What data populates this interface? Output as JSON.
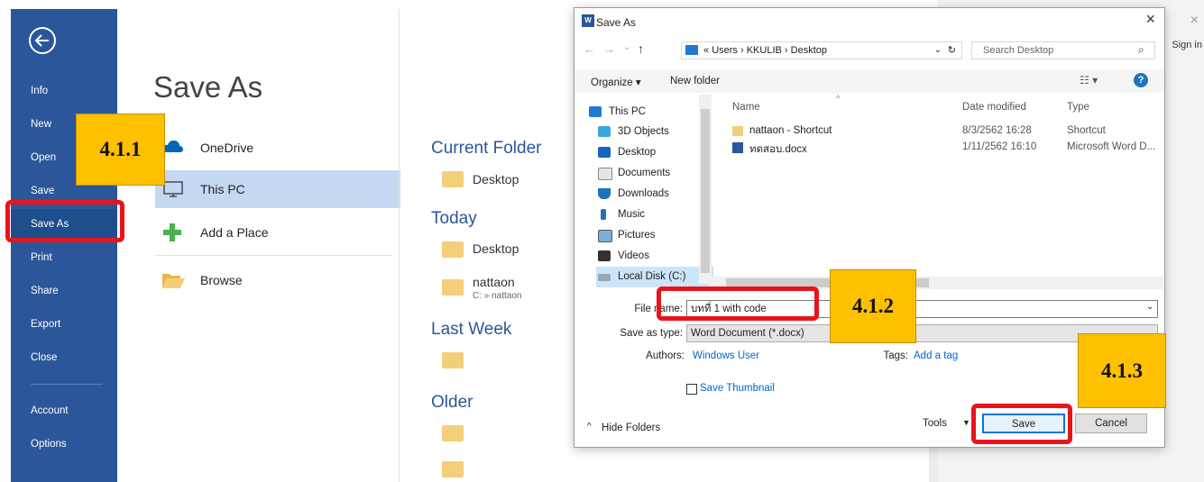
{
  "sidebar": {
    "items": [
      "Info",
      "New",
      "Open",
      "Save",
      "Save As",
      "Print",
      "Share",
      "Export",
      "Close",
      "Account",
      "Options"
    ],
    "active": "Save As"
  },
  "main": {
    "title": "Save As",
    "locations": [
      "OneDrive",
      "This PC",
      "Add a Place",
      "Browse"
    ],
    "sections": {
      "current_folder": "Current Folder",
      "today": "Today",
      "last_week": "Last Week",
      "older": "Older"
    },
    "folders": {
      "current": "Desktop",
      "today_1": "Desktop",
      "today_2": "nattaon",
      "today_2_path": "C: » nattaon"
    }
  },
  "right_panel": {
    "sign_in": "Sign in",
    "close_glyph": "×"
  },
  "dialog": {
    "title": "Save As",
    "address_path": [
      "«",
      "Users",
      "›",
      "KKULIB",
      "›",
      "Desktop"
    ],
    "search_placeholder": "Search Desktop",
    "organize": "Organize ▾",
    "new_folder": "New folder",
    "tree": [
      "This PC",
      "3D Objects",
      "Desktop",
      "Documents",
      "Downloads",
      "Music",
      "Pictures",
      "Videos",
      "Local Disk (C:)"
    ],
    "columns": [
      "Name",
      "Date modified",
      "Type"
    ],
    "files": [
      {
        "name": "nattaon - Shortcut",
        "date": "8/3/2562 16:28",
        "type": "Shortcut"
      },
      {
        "name": "ทดสอบ.docx",
        "date": "1/11/2562 16:10",
        "type": "Microsoft Word D..."
      }
    ],
    "file_name_label": "File name:",
    "file_name_value": "บทที่ 1 with code",
    "save_type_label": "Save as type:",
    "save_type_value": "Word Document (*.docx)",
    "authors_label": "Authors:",
    "authors_value": "Windows User",
    "tags_label": "Tags:",
    "tags_value": "Add a tag",
    "save_thumbnail": "Save Thumbnail",
    "hide_folders": "Hide Folders",
    "tools": "Tools",
    "save": "Save",
    "cancel": "Cancel",
    "close_glyph": "×"
  },
  "annotations": {
    "step1": "4.1.1",
    "step2": "4.1.2",
    "step3": "4.1.3",
    "highlight_color": "#e8141c",
    "label_color": "#ffc000"
  }
}
